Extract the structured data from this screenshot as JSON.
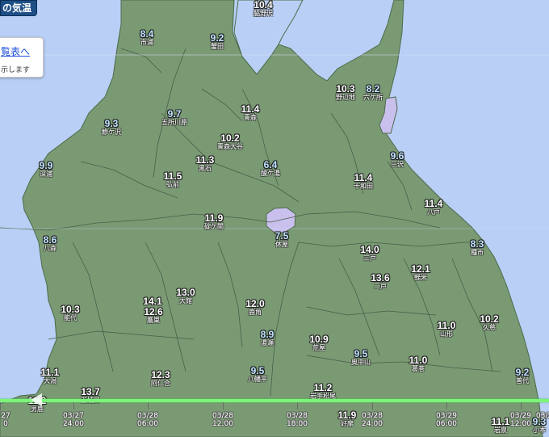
{
  "header": {
    "title_fragment": "の気温"
  },
  "popup": {
    "link_text": "覧表へ",
    "text": "示します"
  },
  "colors": {
    "land": "#7a9a74",
    "sea": "#b9cff5",
    "lake": "#c9c0ee",
    "boundary": "#4a5e48",
    "timeline": "#7cf57a"
  },
  "stations": [
    {
      "value": "10.4",
      "name": "脇野沢",
      "cool": false
    },
    {
      "value": "8.4",
      "name": "市浦",
      "cool": true
    },
    {
      "value": "9.2",
      "name": "蟹田",
      "cool": true
    },
    {
      "value": "10.3",
      "name": "野辺地",
      "cool": false
    },
    {
      "value": "8.2",
      "name": "六ケ所",
      "cool": true
    },
    {
      "value": "9.7",
      "name": "五所川原",
      "cool": true
    },
    {
      "value": "11.4",
      "name": "青森",
      "cool": false
    },
    {
      "value": "9.3",
      "name": "鰺ケ沢",
      "cool": true
    },
    {
      "value": "10.2",
      "name": "青森大谷",
      "cool": false
    },
    {
      "value": "9.6",
      "name": "三沢",
      "cool": true
    },
    {
      "value": "11.3",
      "name": "黒石",
      "cool": false
    },
    {
      "value": "6.4",
      "name": "酸ケ湯",
      "cool": true
    },
    {
      "value": "9.9",
      "name": "深浦",
      "cool": true
    },
    {
      "value": "11.5",
      "name": "弘前",
      "cool": false
    },
    {
      "value": "11.4",
      "name": "十和田",
      "cool": false
    },
    {
      "value": "11.4",
      "name": "八戸",
      "cool": false
    },
    {
      "value": "11.9",
      "name": "碇ケ関",
      "cool": false
    },
    {
      "value": "7.5",
      "name": "休屋",
      "cool": true
    },
    {
      "value": "8.6",
      "name": "八森",
      "cool": true
    },
    {
      "value": "14.0",
      "name": "三戸",
      "cool": false
    },
    {
      "value": "8.3",
      "name": "種市",
      "cool": true
    },
    {
      "value": "13.6",
      "name": "二戸",
      "cool": false
    },
    {
      "value": "12.1",
      "name": "軽米",
      "cool": false
    },
    {
      "value": "13.0",
      "name": "大館",
      "cool": false
    },
    {
      "value": "14.1",
      "name": "",
      "cool": false
    },
    {
      "value": "12.6",
      "name": "鷹巣",
      "cool": false
    },
    {
      "value": "10.3",
      "name": "能代",
      "cool": false
    },
    {
      "value": "12.0",
      "name": "鹿角",
      "cool": false
    },
    {
      "value": "11.0",
      "name": "山形",
      "cool": false
    },
    {
      "value": "10.2",
      "name": "久慈",
      "cool": false
    },
    {
      "value": "8.9",
      "name": "湯瀬",
      "cool": true
    },
    {
      "value": "10.9",
      "name": "荒屋",
      "cool": false
    },
    {
      "value": "9.5",
      "name": "奥中山",
      "cool": true
    },
    {
      "value": "11.0",
      "name": "葛巻",
      "cool": false
    },
    {
      "value": "9.5",
      "name": "八幡平",
      "cool": true
    },
    {
      "value": "12.3",
      "name": "阿仁合",
      "cool": false
    },
    {
      "value": "9.2",
      "name": "普代",
      "cool": true
    },
    {
      "value": "11.1",
      "name": "大潟",
      "cool": false
    },
    {
      "value": "13.7",
      "name": "五城目",
      "cool": false
    },
    {
      "value": "11.2",
      "name": "岩手松尾",
      "cool": false
    },
    {
      "value": "11.9",
      "name": "好摩",
      "cool": false
    },
    {
      "value": "11.1",
      "name": "岩泉",
      "cool": false
    },
    {
      "value": "9.3",
      "name": "小本",
      "cool": true
    },
    {
      "value": "11.2",
      "name": "男鹿",
      "cool": false
    }
  ],
  "timeline": {
    "labels": [
      {
        "date": "27",
        "time": "0"
      },
      {
        "date": "03/27",
        "time": "24:00"
      },
      {
        "date": "03/28",
        "time": "06:00"
      },
      {
        "date": "03/28",
        "time": "12:00"
      },
      {
        "date": "03/28",
        "time": "18:00"
      },
      {
        "date": "03/28",
        "time": "24:00"
      },
      {
        "date": "03/29",
        "time": "06:00"
      },
      {
        "date": "03/29",
        "time": "12:00"
      },
      {
        "date": "03/2",
        "time": ""
      }
    ]
  }
}
